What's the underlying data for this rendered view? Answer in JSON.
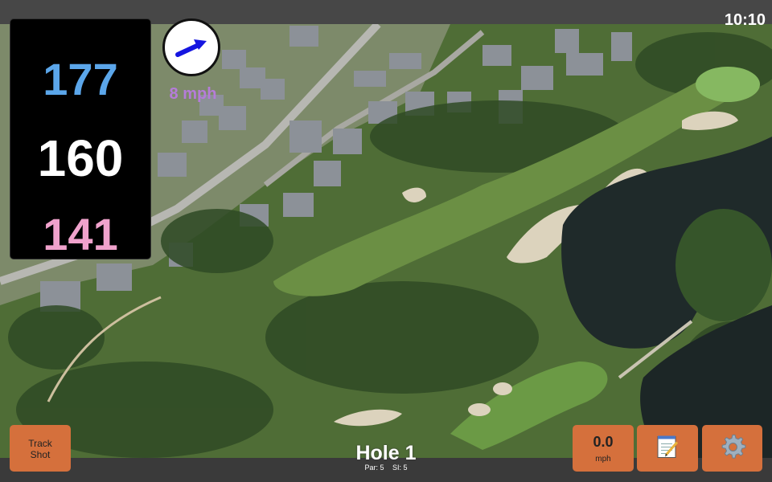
{
  "status": {
    "time": "10:10"
  },
  "distances": {
    "back": "177",
    "center": "160",
    "front": "141"
  },
  "wind": {
    "speed": "8 mph",
    "arrow_icon": "wind-direction-arrow-icon"
  },
  "buttons": {
    "track_shot_line1": "Track",
    "track_shot_line2": "Shot",
    "swing_speed_value": "0.0",
    "swing_speed_unit": "mph",
    "notes_icon": "notepad-icon",
    "settings_icon": "gear-icon"
  },
  "hole": {
    "title": "Hole 1",
    "par": "Par: 5",
    "si": "SI: 5"
  },
  "colors": {
    "back": "#5ba6ea",
    "center": "#ffffff",
    "front": "#f0a2cc",
    "wind_text": "#b57cd9",
    "button": "#d5703c",
    "fairway": "#6b8f44",
    "green": "#86b861",
    "bunker": "#dcd3bd",
    "water": "#1f2a2a"
  }
}
